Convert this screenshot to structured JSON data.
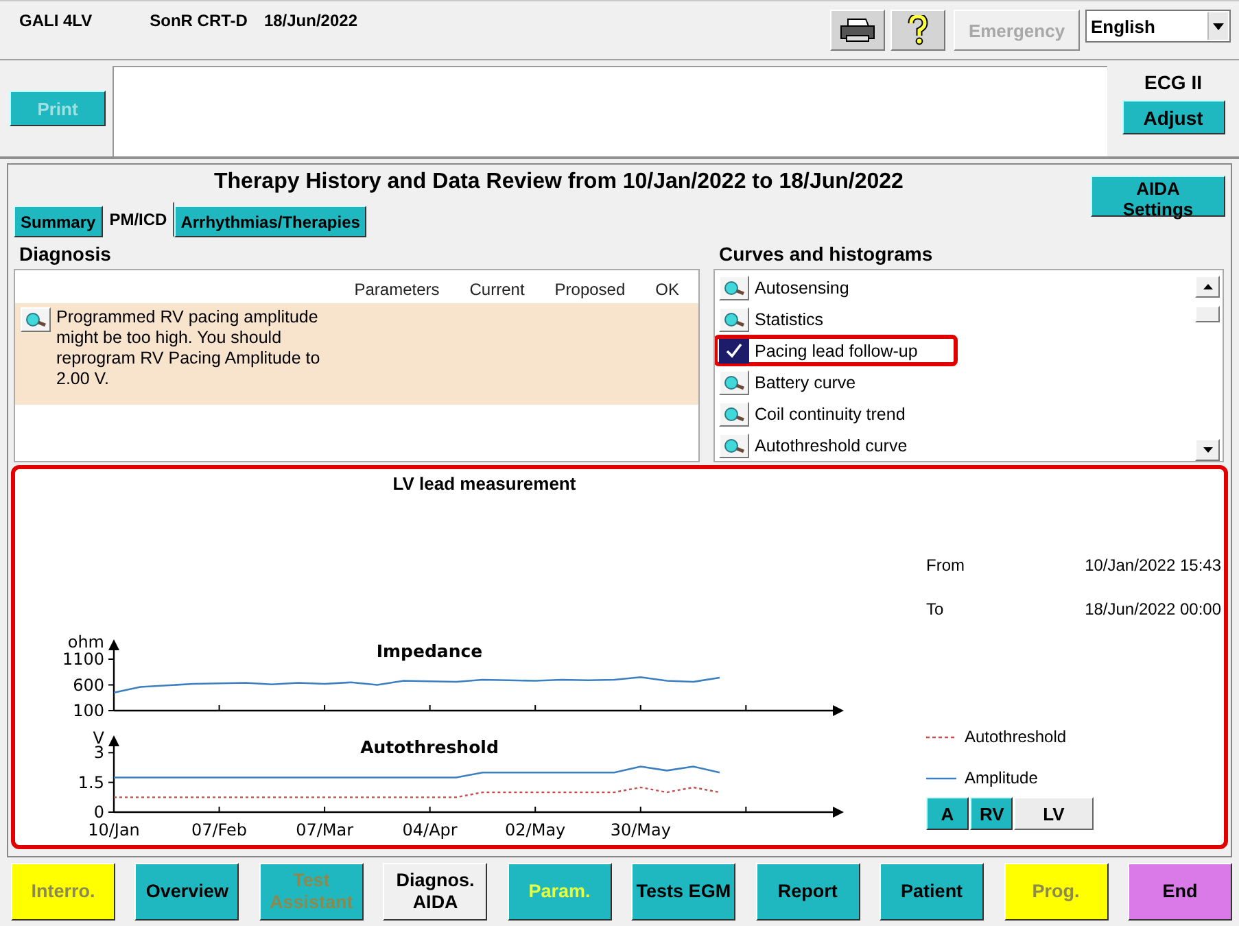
{
  "header": {
    "patient": "GALI 4LV",
    "device": "SonR CRT-D",
    "date": "18/Jun/2022",
    "emergency": {
      "label": "Emergency",
      "disabled": true
    },
    "language": "English"
  },
  "print_button": {
    "label": "Print",
    "disabled": true
  },
  "ecg": {
    "label": "ECG II",
    "button": "Adjust"
  },
  "review": {
    "title": "Therapy History and Data Review from 10/Jan/2022 to 18/Jun/2022",
    "tabs": [
      {
        "label": "Summary",
        "selected": false
      },
      {
        "label": "PM/ICD",
        "selected": true
      },
      {
        "label": "Arrhythmias/Therapies",
        "selected": false
      }
    ],
    "settings_button": "AIDA Settings"
  },
  "diagnosis": {
    "heading": "Diagnosis",
    "columns": [
      "Parameters",
      "Current",
      "Proposed",
      "OK"
    ],
    "messages": [
      {
        "text": "Programmed RV pacing amplitude might be too high. You should reprogram RV Pacing Amplitude to 2.00 V."
      }
    ]
  },
  "curves": {
    "heading": "Curves and histograms",
    "items": [
      {
        "label": "Autosensing",
        "checked": false,
        "highlighted": false
      },
      {
        "label": "Statistics",
        "checked": false,
        "highlighted": false
      },
      {
        "label": "Pacing lead follow-up",
        "checked": true,
        "highlighted": true
      },
      {
        "label": "Battery curve",
        "checked": false,
        "highlighted": false
      },
      {
        "label": "Coil continuity trend",
        "checked": false,
        "highlighted": false
      },
      {
        "label": "Autothreshold curve",
        "checked": false,
        "highlighted": false
      }
    ]
  },
  "lead_panel": {
    "title": "LV lead measurement",
    "highlighted": true,
    "charts": [
      {
        "chart_data": {
          "type": "line",
          "title": "Impedance",
          "ylabel": "ohm",
          "ylim": [
            100,
            1380
          ],
          "yticks": [
            100,
            600,
            1100
          ],
          "series": [
            {
              "color": "#3c7fc0",
              "values": [
                450,
                560,
                590,
                620,
                630,
                640,
                610,
                640,
                620,
                650,
                600,
                680,
                670,
                660,
                700,
                690,
                680,
                700,
                690,
                700,
                750,
                680,
                660,
                740
              ]
            }
          ]
        }
      },
      {
        "chart_data": {
          "type": "line",
          "title": "Autothreshold",
          "ylabel": "V",
          "categories": [
            "10/Jan",
            null,
            null,
            null,
            "07/Feb",
            null,
            null,
            null,
            "07/Mar",
            null,
            null,
            null,
            "04/Apr",
            null,
            null,
            null,
            "02/May",
            null,
            null,
            null,
            "30/May",
            null,
            null,
            null
          ],
          "ylim": [
            0,
            3.6
          ],
          "yticks": [
            0,
            1.5,
            3
          ],
          "legend": "right",
          "series": [
            {
              "name": "Autothreshold",
              "color": "#c0504d",
              "line_style": "dashed",
              "values": [
                0.75,
                0.75,
                0.75,
                0.75,
                0.75,
                0.75,
                0.75,
                0.75,
                0.75,
                0.75,
                0.75,
                0.75,
                0.75,
                0.75,
                1,
                1,
                1,
                1,
                1,
                1,
                1.25,
                1,
                1.25,
                1
              ]
            },
            {
              "name": "Amplitude",
              "color": "#3c7fc0",
              "line_style": "solid",
              "values": [
                1.75,
                1.75,
                1.75,
                1.75,
                1.75,
                1.75,
                1.75,
                1.75,
                1.75,
                1.75,
                1.75,
                1.75,
                1.75,
                1.75,
                2,
                2,
                2,
                2,
                2,
                2,
                2.3,
                2.1,
                2.3,
                2
              ]
            }
          ]
        }
      }
    ],
    "period": [
      {
        "label": "From",
        "value": "10/Jan/2022 15:43"
      },
      {
        "label": "To",
        "value": "18/Jun/2022 00:00"
      }
    ],
    "lead_buttons": [
      {
        "label": "A",
        "selected": false
      },
      {
        "label": "RV",
        "selected": false
      },
      {
        "label": "LV",
        "selected": true
      }
    ]
  },
  "footer": [
    {
      "label": "Interro.",
      "color": "#ffff00",
      "disabled": true,
      "active": false
    },
    {
      "label": "Overview",
      "color": "#20b8c0",
      "disabled": false,
      "active": false
    },
    {
      "label": "Test Assistant",
      "color": "#20b8c0",
      "disabled": true,
      "active": false
    },
    {
      "label": "Diagnos. AIDA",
      "color": "#f0f0f0",
      "disabled": false,
      "active": false
    },
    {
      "label": "Param.",
      "color": "#20b8c0",
      "disabled": false,
      "active": true
    },
    {
      "label": "Tests EGM",
      "color": "#20b8c0",
      "disabled": false,
      "active": false
    },
    {
      "label": "Report",
      "color": "#20b8c0",
      "disabled": false,
      "active": false
    },
    {
      "label": "Patient",
      "color": "#20b8c0",
      "disabled": false,
      "active": false
    },
    {
      "label": "Prog.",
      "color": "#ffff00",
      "disabled": true,
      "active": false
    },
    {
      "label": "End",
      "color": "#d97ae8",
      "disabled": false,
      "active": false
    }
  ]
}
